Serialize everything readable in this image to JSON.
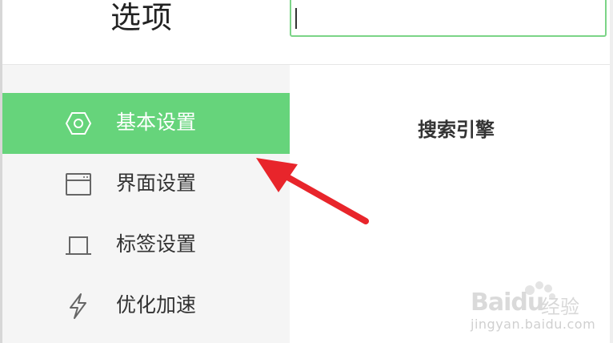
{
  "header": {
    "title": "选项",
    "search": {
      "value": "",
      "placeholder": ""
    }
  },
  "sidebar": {
    "items": [
      {
        "label": "基本设置",
        "icon": "hexagon-settings-icon",
        "active": true
      },
      {
        "label": "界面设置",
        "icon": "window-icon",
        "active": false
      },
      {
        "label": "标签设置",
        "icon": "tab-icon",
        "active": false
      },
      {
        "label": "优化加速",
        "icon": "lightning-icon",
        "active": false
      }
    ]
  },
  "main": {
    "heading": "搜索引擎"
  },
  "annotation": {
    "color": "#e8252b"
  },
  "watermark": {
    "brand": "Baidu",
    "cn": "经验",
    "url": "jingyan.baidu.com"
  },
  "colors": {
    "accent": "#66d47b",
    "sidebar_bg": "#f5f5f5",
    "search_border": "#7bd487"
  }
}
